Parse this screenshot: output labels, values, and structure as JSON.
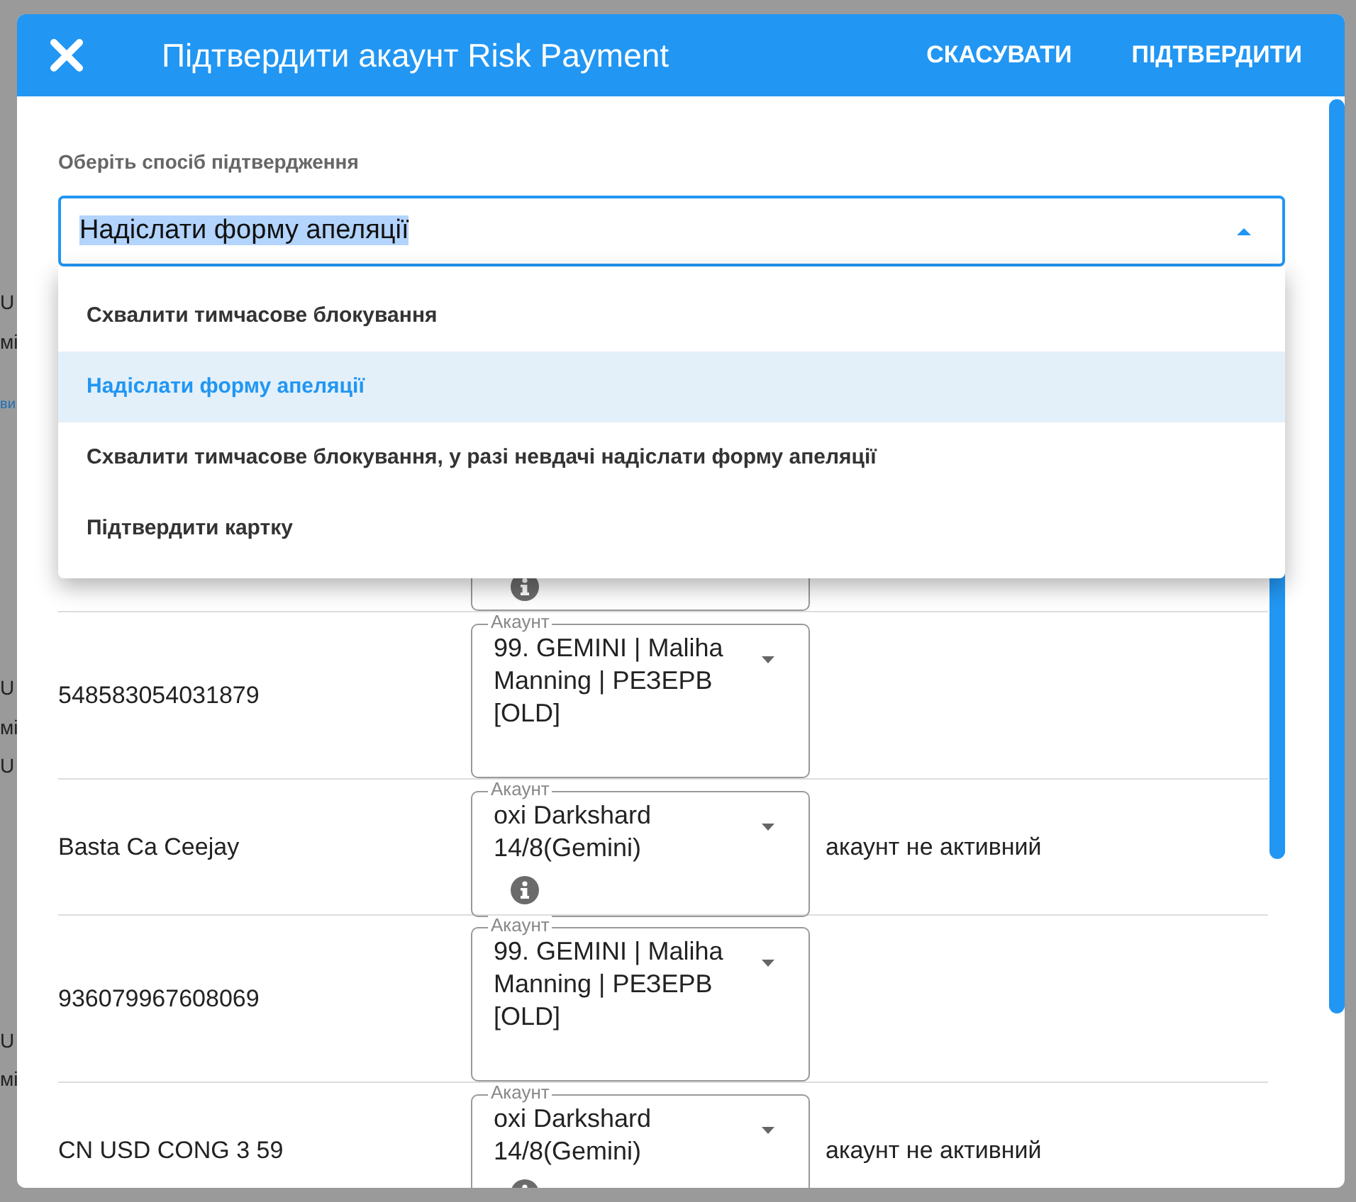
{
  "background_fragments": [
    {
      "text": "U",
      "kind": "plain"
    },
    {
      "text": "мі",
      "kind": "plain"
    },
    {
      "text": "ви",
      "kind": "link"
    },
    {
      "text": "U",
      "kind": "plain"
    },
    {
      "text": "мі",
      "kind": "plain"
    },
    {
      "text": "U",
      "kind": "plain"
    },
    {
      "text": "U",
      "kind": "plain"
    },
    {
      "text": "мі",
      "kind": "plain"
    }
  ],
  "dialog": {
    "title": "Підтвердити акаунт Risk Payment",
    "actions": [
      "СКАСУВАТИ",
      "ПІДТВЕРДИТИ"
    ]
  },
  "method_select": {
    "label": "Оберіть спосіб підтвердження",
    "value": "Надіслати форму апеляції",
    "text_selected": true,
    "expanded": true,
    "options": [
      {
        "label": "Схвалити тимчасове блокування",
        "selected": false
      },
      {
        "label": "Надіслати форму апеляції",
        "selected": true
      },
      {
        "label": "Схвалити тимчасове блокування, у разі невдачі надіслати форму апеляції",
        "selected": false
      },
      {
        "label": "Підтвердити картку",
        "selected": false
      }
    ]
  },
  "rows": [
    {
      "kind": "partial",
      "info": true
    },
    {
      "kind": "full",
      "card": "548583054031879",
      "account_label": "Акаунт",
      "account": "99. GEMINI | Maliha Manning | РЕЗЕРВ [OLD]",
      "info": false
    },
    {
      "kind": "full",
      "card": "Basta Ca Ceejay",
      "account_label": "Акаунт",
      "account": "oxi Darkshard 14/8(Gemini)",
      "info": true,
      "status": "акаунт не активний"
    },
    {
      "kind": "full",
      "card": "936079967608069",
      "account_label": "Акаунт",
      "account": "99. GEMINI | Maliha Manning | РЕЗЕРВ [OLD]",
      "info": false
    },
    {
      "kind": "full",
      "card": "CN USD CONG 3 59",
      "account_label": "Акаунт",
      "account": "oxi Darkshard 14/8(Gemini)",
      "info": true,
      "status": "акаунт не активний"
    }
  ]
}
